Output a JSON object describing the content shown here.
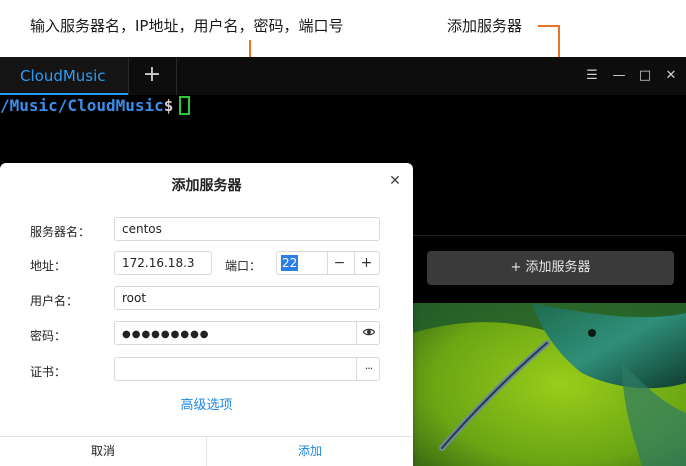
{
  "annotations": {
    "left_text": "输入服务器名，IP地址，用户名，密码，端口号",
    "right_text": "添加服务器",
    "color": "#e8742a"
  },
  "window": {
    "tab_label": "CloudMusic",
    "add_tab_symbol": "+",
    "controls": {
      "menu": "☰",
      "minimize": "—",
      "maximize": "□",
      "close": "✕"
    }
  },
  "terminal": {
    "path": "/Music/CloudMusic",
    "prompt": "$"
  },
  "sidebar": {
    "add_server_label": "+ 添加服务器"
  },
  "dialog": {
    "title": "添加服务器",
    "close_symbol": "✕",
    "server_name_label": "服务器名：",
    "server_name_value": "centos",
    "address_label": "地址：",
    "address_value": "172.16.18.3",
    "port_label": "端口：",
    "port_value": "22",
    "decrement_symbol": "−",
    "increment_symbol": "+",
    "username_label": "用户名：",
    "username_value": "root",
    "password_label": "密码：",
    "password_value": "●●●●●●●●●",
    "show_password_icon": "eye-icon",
    "certificate_label": "证书：",
    "certificate_value": "",
    "browse_symbol": "···",
    "advanced_label": "高级选项",
    "cancel_label": "取消",
    "add_label": "添加",
    "accent_color": "#1e88e5"
  }
}
